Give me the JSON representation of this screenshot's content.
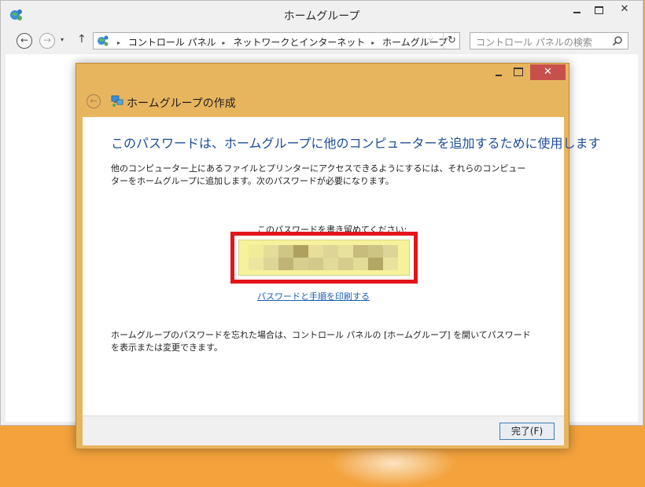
{
  "window": {
    "title": "ホームグループ",
    "min_icon": "minimize-icon",
    "max_icon": "maximize-icon",
    "close_glyph": "✕"
  },
  "nav": {
    "back_glyph": "←",
    "forward_glyph": "→",
    "recent_glyph": "▾",
    "up_glyph": "↑",
    "dropdown_glyph": "⌵",
    "refresh_glyph": "↻"
  },
  "breadcrumb": {
    "items": [
      "コントロール パネル",
      "ネットワークとインターネット",
      "ホームグループ"
    ],
    "separator": "▸"
  },
  "search": {
    "placeholder": "コントロール パネルの検索"
  },
  "dialog": {
    "title": "ホームグループの作成",
    "back_glyph": "←",
    "close_glyph": "✕",
    "heading": "このパスワードは、ホームグループに他のコンピューターを追加するために使用します",
    "description": "他のコンピューター上にあるファイルとプリンターにアクセスできるようにするには、それらのコンピューターをホームグループに追加します。次のパスワードが必要になります。",
    "password_label": "このパスワードを書き留めてください:",
    "print_link": "パスワードと手順を印刷する",
    "forgot_text": "ホームグループのパスワードを忘れた場合は、コントロール パネルの [ホームグループ] を開いてパスワードを表示または変更できます。",
    "finish_button": "完了(F)"
  },
  "colors": {
    "dialog_frame": "#e8b55f",
    "close_red": "#c7504d",
    "heading_blue": "#1e4d9a",
    "link_blue": "#1b5fb5",
    "highlight_red": "#e4141b",
    "password_bg": "#f6f29c"
  }
}
